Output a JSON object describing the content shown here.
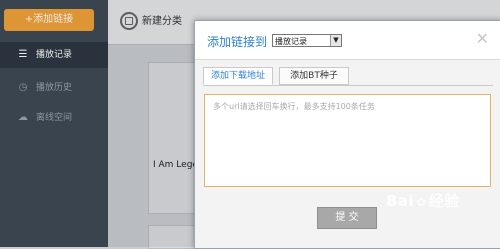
{
  "sidebar": {
    "add_link_label": "+添加链接",
    "items": [
      {
        "label": "播放记录",
        "icon": "list-icon"
      },
      {
        "label": "播放历史",
        "icon": "clock-icon"
      },
      {
        "label": "离线空间",
        "icon": "cloud-icon"
      }
    ]
  },
  "topbar": {
    "new_category_label": "新建分类"
  },
  "content": {
    "card_title": "I Am Legen"
  },
  "dialog": {
    "title": "添加链接到",
    "target_select_value": "播放记录",
    "close_icon": "close-icon",
    "tabs": [
      {
        "label": "添加下载地址",
        "active": true
      },
      {
        "label": "添加BT种子",
        "active": false
      }
    ],
    "url_placeholder": "多个url请选择回车换行，最多支持100条任务",
    "submit_label": "提 交"
  },
  "watermark": {
    "text_left": "Bai",
    "text_right": "经验"
  },
  "colors": {
    "accent": "#2d7fd1",
    "add_button": "#f0a23a",
    "sidebar_bg": "#3f4a55"
  }
}
